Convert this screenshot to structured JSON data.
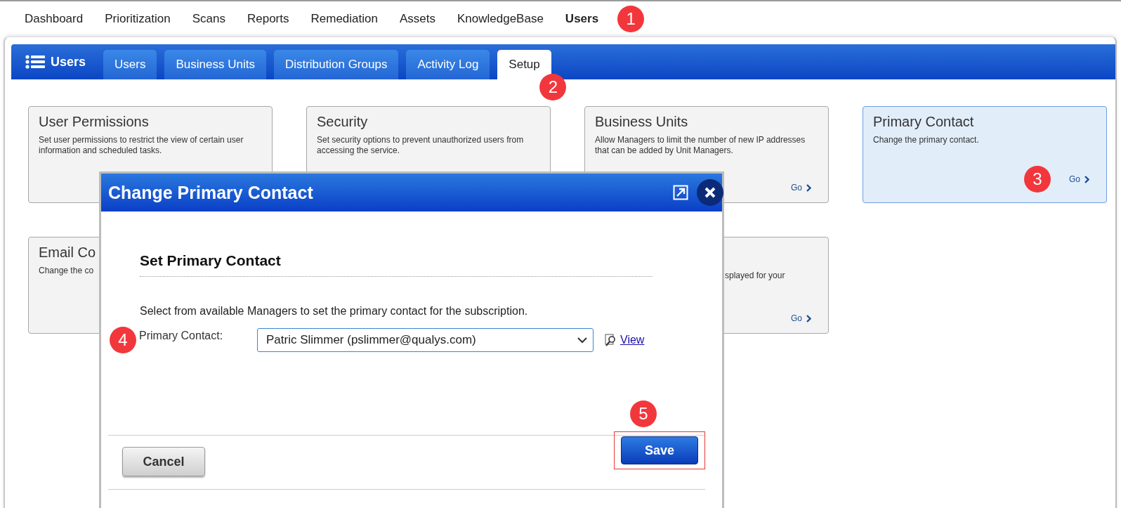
{
  "top_nav": [
    {
      "label": "Dashboard",
      "selected": false
    },
    {
      "label": "Prioritization",
      "selected": false
    },
    {
      "label": "Scans",
      "selected": false
    },
    {
      "label": "Reports",
      "selected": false
    },
    {
      "label": "Remediation",
      "selected": false
    },
    {
      "label": "Assets",
      "selected": false
    },
    {
      "label": "KnowledgeBase",
      "selected": false
    },
    {
      "label": "Users",
      "selected": true,
      "callout": "1"
    }
  ],
  "panel": {
    "title": "Users",
    "tabs": [
      {
        "label": "Users",
        "selected": false
      },
      {
        "label": "Business Units",
        "selected": false
      },
      {
        "label": "Distribution Groups",
        "selected": false
      },
      {
        "label": "Activity Log",
        "selected": false
      },
      {
        "label": "Setup",
        "selected": true,
        "callout": "2"
      }
    ]
  },
  "cards": [
    {
      "title": "User Permissions",
      "description": "Set user permissions to restrict the view of certain user information and scheduled tasks.",
      "selected": false
    },
    {
      "title": "Security",
      "description": "Set security options to prevent unauthorized users from accessing the service.",
      "selected": false
    },
    {
      "title": "Business Units",
      "description": "Allow Managers to limit the number of new IP addresses that can be added by Unit Managers.",
      "go": "Go",
      "selected": false
    },
    {
      "title": "Primary Contact",
      "description": "Change the primary contact.",
      "go": "Go",
      "selected": true,
      "callout": "3"
    },
    {
      "title": "Email Co",
      "description": "Change the co",
      "selected": false
    },
    {
      "description": "splayed for your",
      "go": "Go",
      "selected": false
    }
  ],
  "dialog": {
    "title": "Change Primary Contact",
    "heading": "Set Primary Contact",
    "instructions": "Select from available Managers to set the primary contact for the subscription.",
    "field": {
      "label": "Primary Contact:",
      "value": "Patric Slimmer (pslimmer@qualys.com)",
      "callout": "4"
    },
    "view_link": "View",
    "buttons": [
      {
        "kind": "secondary",
        "label": "Cancel"
      },
      {
        "kind": "primary",
        "label": "Save",
        "highlighted": true,
        "callout": "5"
      }
    ]
  }
}
